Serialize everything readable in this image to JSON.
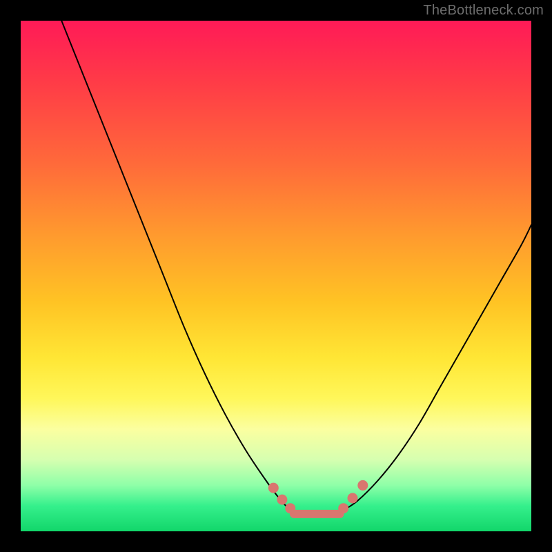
{
  "watermark": "TheBottleneck.com",
  "colors": {
    "frame": "#000000",
    "watermark_text": "#6d6d6d",
    "marker": "#d9766f",
    "curve": "#000000"
  },
  "chart_data": {
    "type": "line",
    "title": "",
    "xlabel": "",
    "ylabel": "",
    "xlim": [
      0,
      100
    ],
    "ylim": [
      0,
      100
    ],
    "grid": false,
    "legend": false,
    "series": [
      {
        "name": "left-curve",
        "x": [
          8,
          12,
          16,
          20,
          24,
          28,
          32,
          36,
          40,
          44,
          48,
          51,
          53
        ],
        "y": [
          100,
          90,
          80,
          70,
          60,
          50,
          40,
          31,
          23,
          16,
          10,
          6,
          4
        ]
      },
      {
        "name": "right-curve",
        "x": [
          63,
          66,
          70,
          74,
          78,
          82,
          86,
          90,
          94,
          98,
          100
        ],
        "y": [
          4,
          6,
          10,
          15,
          21,
          28,
          35,
          42,
          49,
          56,
          60
        ]
      },
      {
        "name": "floor",
        "x": [
          53,
          55,
          57,
          59,
          61,
          63
        ],
        "y": [
          4,
          3.5,
          3.2,
          3.2,
          3.5,
          4
        ]
      }
    ],
    "markers": [
      {
        "x": 49.5,
        "y": 8.5
      },
      {
        "x": 51.2,
        "y": 6.2
      },
      {
        "x": 52.8,
        "y": 4.5
      },
      {
        "x": 63.2,
        "y": 4.5
      },
      {
        "x": 65.0,
        "y": 6.5
      },
      {
        "x": 67.0,
        "y": 9.0
      }
    ],
    "floor_segment": {
      "x0": 53.5,
      "x1": 62.5,
      "y": 3.4
    }
  }
}
